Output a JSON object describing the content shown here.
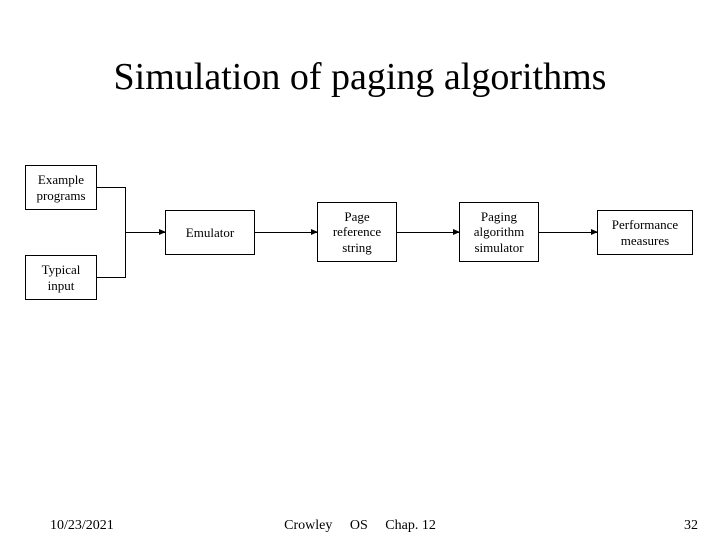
{
  "title": "Simulation of paging algorithms",
  "boxes": {
    "example_programs": "Example\nprograms",
    "typical_input": "Typical\ninput",
    "emulator": "Emulator",
    "page_reference_string": "Page\nreference\nstring",
    "paging_algorithm_simulator": "Paging\nalgorithm\nsimulator",
    "performance_measures": "Performance\nmeasures"
  },
  "footer": {
    "date": "10/23/2021",
    "author": "Crowley",
    "course": "OS",
    "chapter": "Chap. 12",
    "page": "32"
  }
}
